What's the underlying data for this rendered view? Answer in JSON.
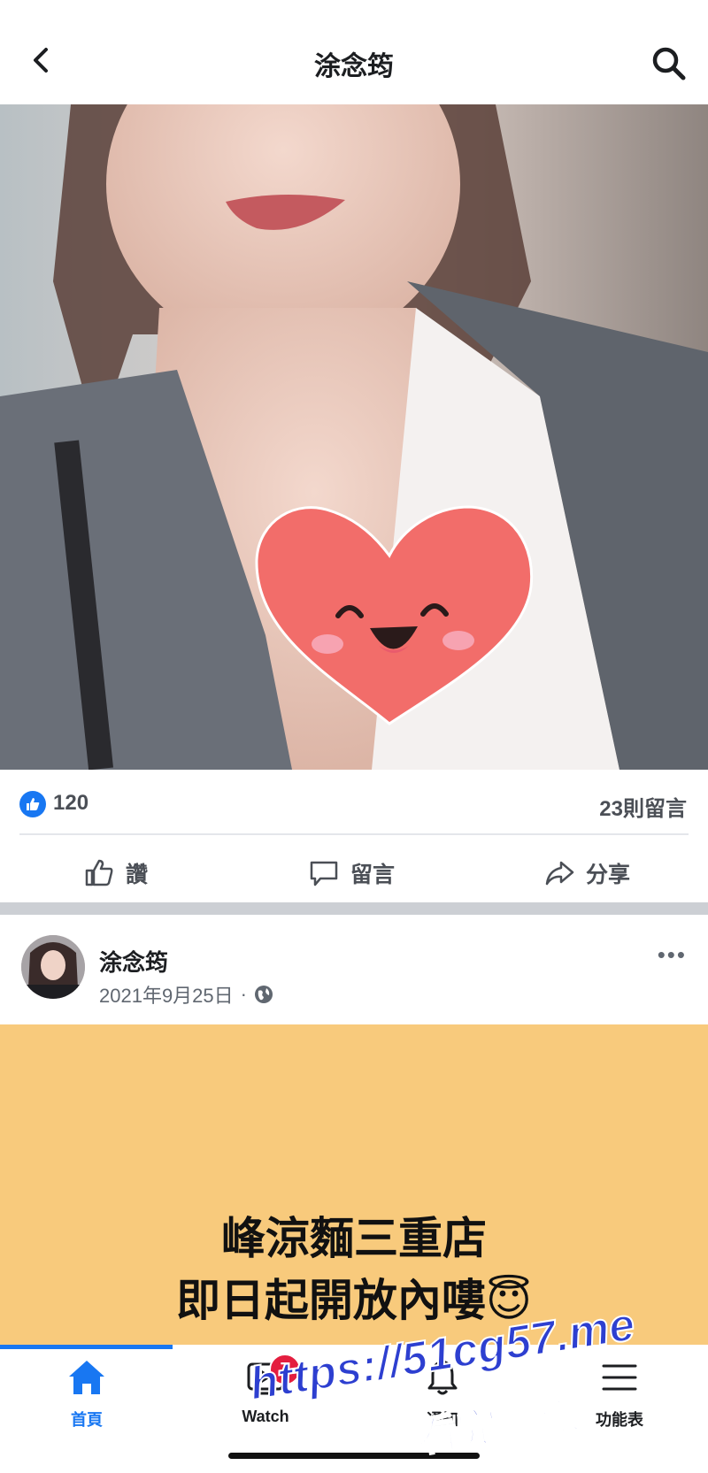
{
  "header": {
    "title": "涂念筠",
    "back_icon": "chevron-left-icon",
    "search_icon": "search-icon"
  },
  "reactions": {
    "like_count": "120",
    "comments_count": "23則留言"
  },
  "actions": {
    "like_label": "讚",
    "comment_label": "留言",
    "share_label": "分享"
  },
  "post": {
    "author": "涂念筠",
    "date": "2021年9月25日",
    "separator": "·",
    "line1": "峰涼麵三重店",
    "line2": "即日起開放內嘍😇"
  },
  "tabs": [
    {
      "label": "首頁",
      "icon": "home-icon"
    },
    {
      "label": "Watch",
      "icon": "watch-icon",
      "badge": "7"
    },
    {
      "label": "通知",
      "icon": "bell-icon"
    },
    {
      "label": "功能表",
      "icon": "menu-icon"
    }
  ],
  "watermark": {
    "url": "https://51cg57.me",
    "subtitle": "看完整版"
  },
  "colors": {
    "accent": "#1877f2",
    "post_background": "#f8ca7c",
    "badge": "#e41e3f",
    "watermark": "#2d3fd0"
  }
}
